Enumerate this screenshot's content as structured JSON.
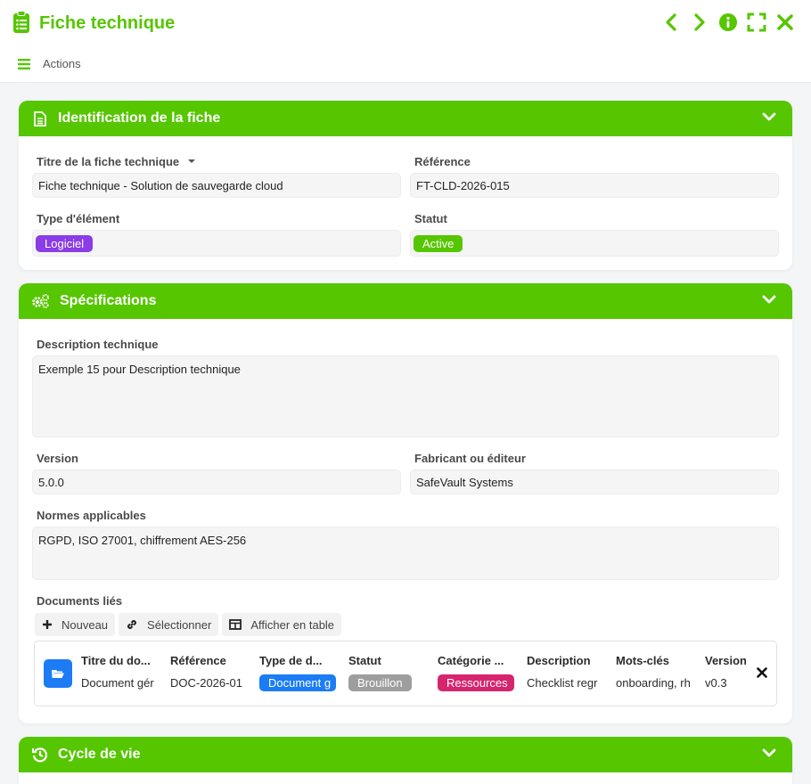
{
  "header": {
    "title": "Fiche technique",
    "actions_label": "Actions"
  },
  "icons": {
    "title": "clipboard-list-icon",
    "prev": "chevron-left-icon",
    "next": "chevron-right-icon",
    "info": "info-circle-icon",
    "fullscreen": "expand-icon",
    "close": "close-icon",
    "menu": "hamburger-menu-icon"
  },
  "colors": {
    "accent": "#56c600",
    "logiciel": "#8a3ce6",
    "active": "#56c600",
    "doc_type": "#1b7cf5",
    "brouillon": "#9e9e9e",
    "ressources": "#d6246e"
  },
  "identification": {
    "title": "Identification de la fiche",
    "titre_label": "Titre de la fiche technique",
    "titre_value": "Fiche technique - Solution de sauvegarde cloud",
    "reference_label": "Référence",
    "reference_value": "FT-CLD-2026-015",
    "type_label": "Type d'élément",
    "type_value": "Logiciel",
    "statut_label": "Statut",
    "statut_value": "Active"
  },
  "specifications": {
    "title": "Spécifications",
    "description_label": "Description technique",
    "description_value": "Exemple 15 pour Description technique",
    "version_label": "Version",
    "version_value": "5.0.0",
    "fabricant_label": "Fabricant ou éditeur",
    "fabricant_value": "SafeVault Systems",
    "normes_label": "Normes applicables",
    "normes_value": "RGPD, ISO 27001, chiffrement AES-256",
    "documents_label": "Documents liés",
    "toolbar": {
      "nouveau": "Nouveau",
      "selectionner": "Sélectionner",
      "afficher_table": "Afficher en table"
    },
    "table": {
      "headers": [
        "Titre du do...",
        "Référence",
        "Type de d...",
        "Statut",
        "Catégorie ...",
        "Description",
        "Mots-clés",
        "Version"
      ],
      "rows": [
        [
          "Document gér",
          "DOC-2026-01",
          "Document g",
          "Brouillon",
          "Ressources",
          "Checklist regr",
          "onboarding, rh",
          "v0.3"
        ]
      ]
    }
  },
  "cycle": {
    "title": "Cycle de vie"
  }
}
